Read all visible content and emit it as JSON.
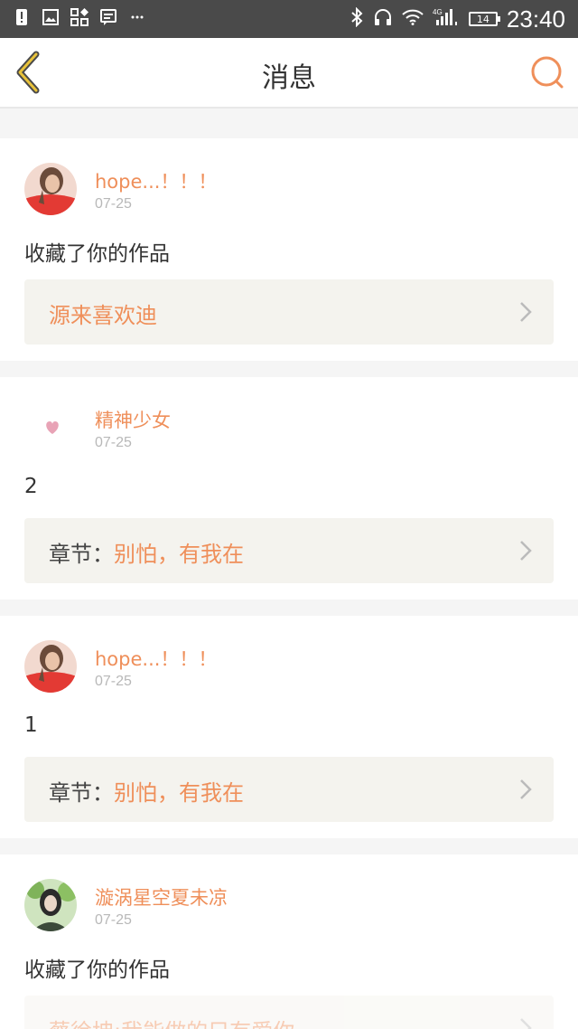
{
  "status_bar": {
    "time": "23:40",
    "battery": "14",
    "network": "4G"
  },
  "header": {
    "title": "消息"
  },
  "colors": {
    "accent": "#ef8f5a",
    "back_arrow": "#e8c23a",
    "ref_bg": "#f4f3ee"
  },
  "messages": [
    {
      "user": "hope...！！！",
      "date": "07-25",
      "text": "收藏了你的作品",
      "ref_label": "",
      "ref_value": "源来喜欢迪",
      "avatar": "avatar-red-dress"
    },
    {
      "user": "精神少女",
      "date": "07-25",
      "text": "2",
      "ref_label": "章节：",
      "ref_value": "别怕，有我在",
      "avatar": "avatar-heart"
    },
    {
      "user": "hope...！！！",
      "date": "07-25",
      "text": "1",
      "ref_label": "章节：",
      "ref_value": "别怕，有我在",
      "avatar": "avatar-red-dress"
    },
    {
      "user": "漩涡星空夏未凉",
      "date": "07-25",
      "text": "收藏了你的作品",
      "ref_label": "",
      "ref_value": "蔡徐坤:我能做的只有爱你",
      "avatar": "avatar-green-leaves"
    }
  ]
}
